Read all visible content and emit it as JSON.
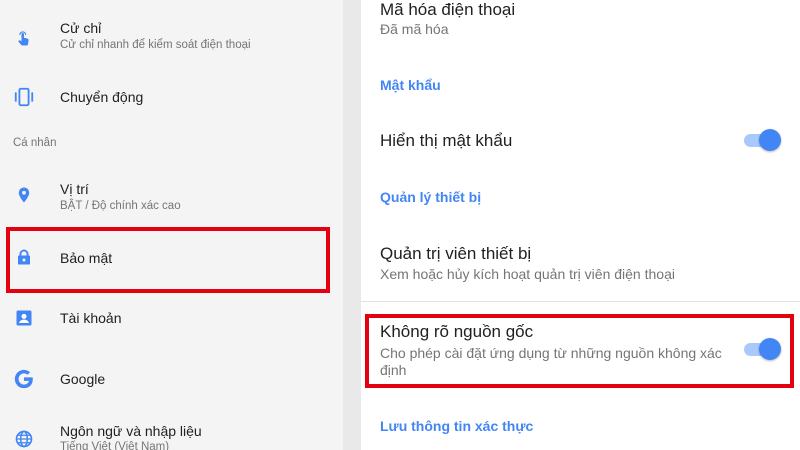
{
  "left": {
    "items": [
      {
        "title": "Cử chỉ",
        "sub": "Cử chỉ nhanh để kiểm soát điện thoại",
        "icon": "gesture-hand-icon"
      },
      {
        "title": "Chuyển động",
        "icon": "motion-phone-icon"
      },
      {
        "section": "Cá nhân"
      },
      {
        "title": "Vị trí",
        "sub": "BẬT / Độ chính xác cao",
        "icon": "location-pin-icon"
      },
      {
        "title": "Bảo mật",
        "icon": "lock-icon"
      },
      {
        "title": "Tài khoản",
        "icon": "account-icon"
      },
      {
        "title": "Google",
        "icon": "google-icon"
      },
      {
        "title": "Ngôn ngữ và nhập liệu",
        "sub": "Tiếng Việt (Việt Nam)",
        "icon": "globe-icon"
      }
    ]
  },
  "right": {
    "encrypt_title": "Mã hóa điện thoại",
    "encrypt_sub": "Đã mã hóa",
    "cat_password": "Mật khẩu",
    "show_password": "Hiển thị mật khẩu",
    "cat_device_mgmt": "Quản lý thiết bị",
    "device_admin_title": "Quản trị viên thiết bị",
    "device_admin_sub": "Xem hoặc hủy kích hoạt quản trị viên điện thoại",
    "unknown_sources_title": "Không rõ nguồn gốc",
    "unknown_sources_sub": "Cho phép cài đặt ứng dụng từ những nguồn không xác định",
    "cat_credentials": "Lưu thông tin xác thực",
    "show_password_on": true,
    "unknown_sources_on": true
  },
  "colors": {
    "accent": "#4285f4",
    "highlight": "#e3000f"
  }
}
